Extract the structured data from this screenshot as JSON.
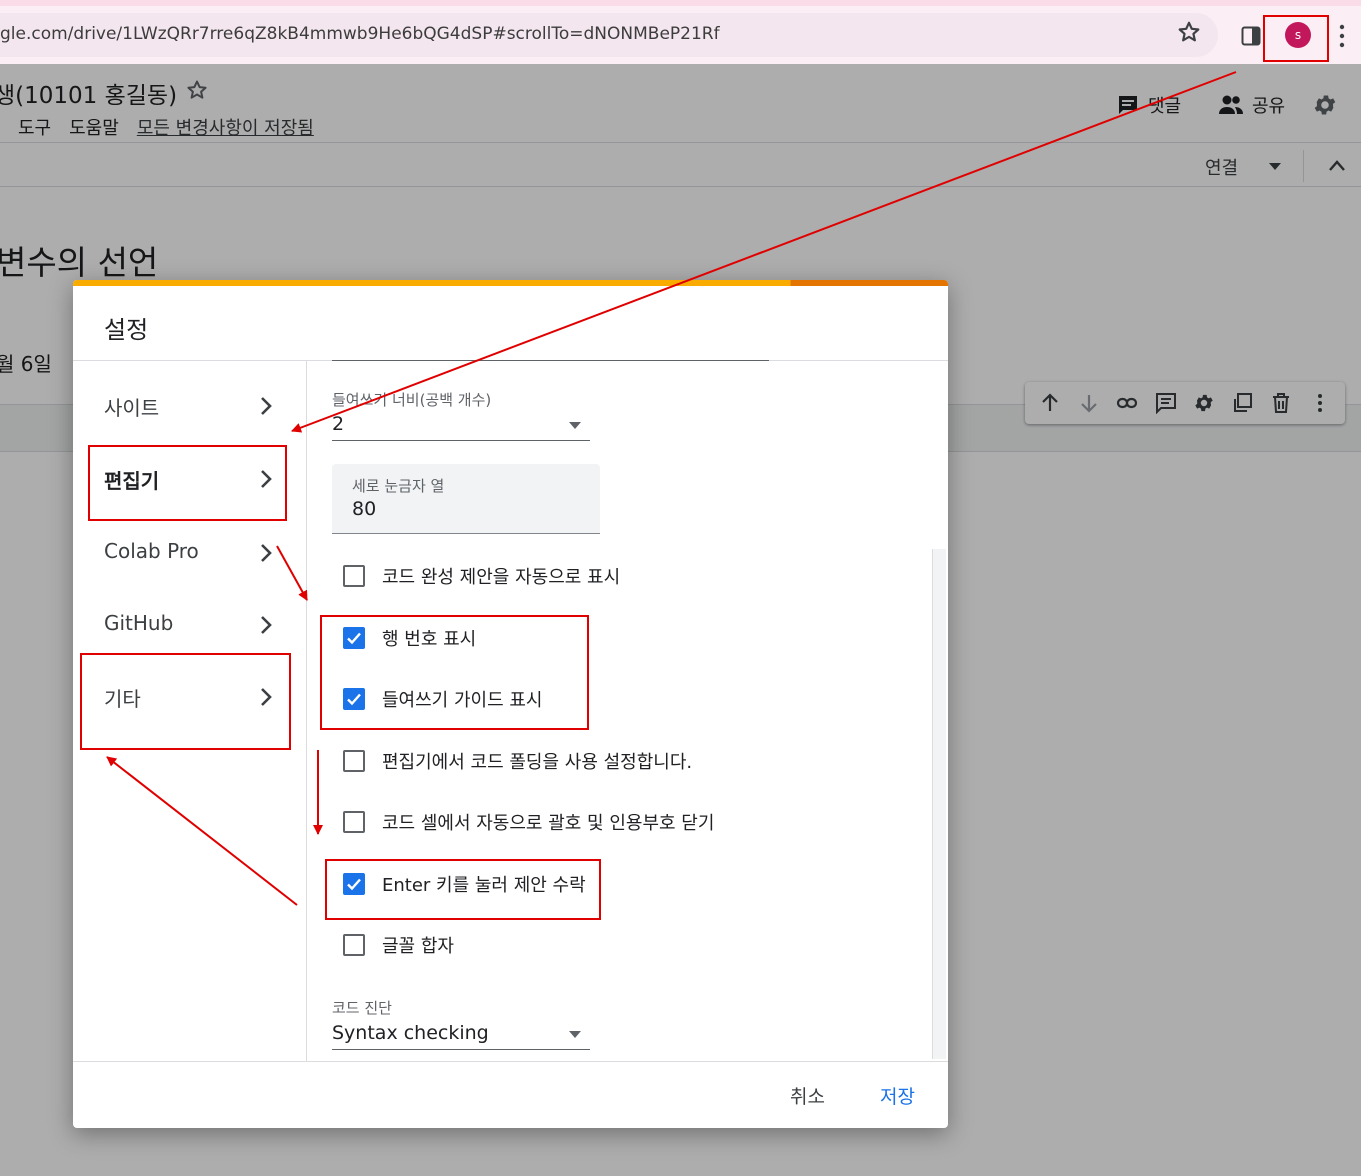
{
  "browser": {
    "url": "gle.com/drive/1LWzQRr7rre6qZ8kB4mmwb9He6bQG4dSP#scrollTo=dNONMBeP21Rf",
    "avatar_initial": "s",
    "avatar_color": "#c2185b"
  },
  "colab": {
    "doc_title": "생(10101 홍길동)",
    "menu": [
      "도구",
      "도움말"
    ],
    "saved_status": "모든 변경사항이 저장됨",
    "comment_label": "댓글",
    "share_label": "공유",
    "connect_label": "연결",
    "heading": "변수의 선언",
    "date_fragment": "월 6일"
  },
  "dialog": {
    "title": "설정",
    "nav": [
      {
        "label": "사이트"
      },
      {
        "label": "편집기"
      },
      {
        "label": "Colab Pro"
      },
      {
        "label": "GitHub"
      },
      {
        "label": "기타"
      }
    ],
    "indent": {
      "label": "들여쓰기 너비(공백 개수)",
      "value": "2"
    },
    "ruler": {
      "label": "세로 눈금자 열",
      "value": "80"
    },
    "checkboxes": [
      {
        "label": "코드 완성 제안을 자동으로 표시",
        "checked": false
      },
      {
        "label": "행 번호 표시",
        "checked": true
      },
      {
        "label": "들여쓰기 가이드 표시",
        "checked": true
      },
      {
        "label": "편집기에서 코드 폴딩을 사용 설정합니다.",
        "checked": false
      },
      {
        "label": "코드 셀에서 자동으로 괄호 및 인용부호 닫기",
        "checked": false
      },
      {
        "label": "Enter 키를 눌러 제안 수락",
        "checked": true
      },
      {
        "label": "글꼴 합자",
        "checked": false
      }
    ],
    "diagnostics": {
      "label": "코드 진단",
      "value": "Syntax checking"
    },
    "cancel_label": "취소",
    "save_label": "저장"
  },
  "colors": {
    "accent": "#1a73e8",
    "annotation": "#e00000",
    "dialog_bar": "#f9ab00"
  }
}
